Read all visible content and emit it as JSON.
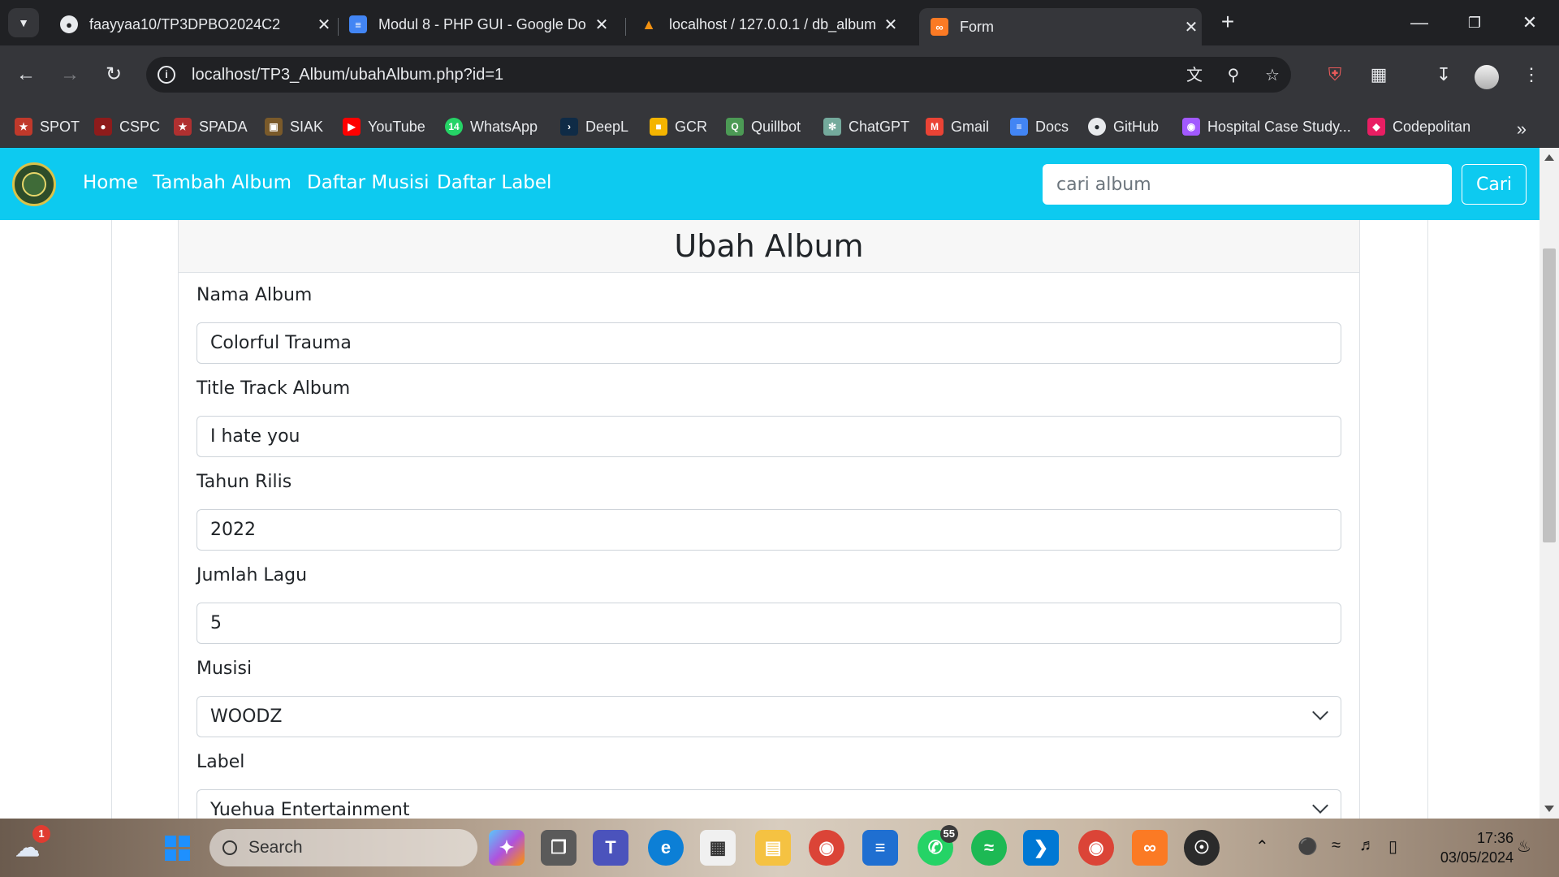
{
  "browser": {
    "tabs": [
      {
        "title": "faayyaa10/TP3DPBO2024C2",
        "icon": "github-icon",
        "active": false
      },
      {
        "title": "Modul 8 - PHP GUI - Google Do",
        "icon": "google-docs-icon",
        "active": false
      },
      {
        "title": "localhost / 127.0.0.1 / db_album",
        "icon": "phpmyadmin-icon",
        "active": false
      },
      {
        "title": "Form",
        "icon": "xampp-icon",
        "active": true
      }
    ],
    "new_tab": "+",
    "url": "localhost/TP3_Album/ubahAlbum.php?id=1",
    "bookmarks": [
      {
        "label": "SPOT",
        "color": "#c0392b"
      },
      {
        "label": "CSPC",
        "color": "#8e1b1b"
      },
      {
        "label": "SPADA",
        "color": "#b03030"
      },
      {
        "label": "SIAK",
        "color": "#7a5a2a"
      },
      {
        "label": "YouTube",
        "color": "#ff0000"
      },
      {
        "label": "WhatsApp",
        "color": "#25d366"
      },
      {
        "label": "DeepL",
        "color": "#0f2b46"
      },
      {
        "label": "GCR",
        "color": "#f4b400"
      },
      {
        "label": "Quillbot",
        "color": "#4c9a55"
      },
      {
        "label": "ChatGPT",
        "color": "#74aa9c"
      },
      {
        "label": "Gmail",
        "color": "#ea4335"
      },
      {
        "label": "Docs",
        "color": "#4285f4"
      },
      {
        "label": "GitHub",
        "color": "#24292e"
      },
      {
        "label": "Hospital Case Study...",
        "color": "#a259ff"
      },
      {
        "label": "Codepolitan",
        "color": "#e91e63"
      }
    ]
  },
  "navbar": {
    "links": [
      "Home",
      "Tambah Album",
      "Daftar Musisi",
      "Daftar Label"
    ],
    "search_placeholder": "cari album",
    "search_button": "Cari"
  },
  "form": {
    "title": "Ubah Album",
    "fields": [
      {
        "label": "Nama Album",
        "value": "Colorful Trauma",
        "type": "text"
      },
      {
        "label": "Title Track Album",
        "value": "I hate you",
        "type": "text"
      },
      {
        "label": "Tahun Rilis",
        "value": "2022",
        "type": "text"
      },
      {
        "label": "Jumlah Lagu",
        "value": "5",
        "type": "text"
      },
      {
        "label": "Musisi",
        "value": "WOODZ",
        "type": "select"
      },
      {
        "label": "Label",
        "value": "Yuehua Entertainment",
        "type": "select"
      }
    ]
  },
  "taskbar": {
    "search_label": "Search",
    "weather_badge": "1",
    "whatsapp_badge": "55",
    "time": "17:36",
    "date": "03/05/2024"
  },
  "colors": {
    "navbar": "#0dcaf0",
    "chrome_dark": "#202124",
    "chrome_toolbar": "#35363a"
  }
}
